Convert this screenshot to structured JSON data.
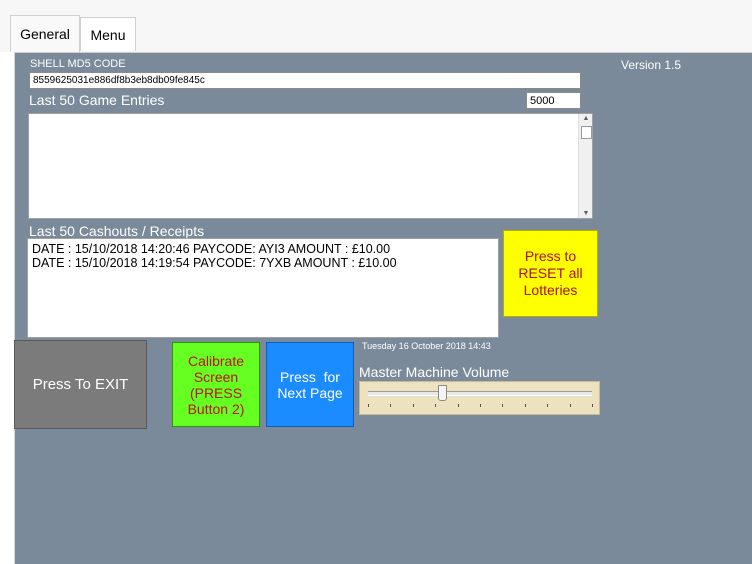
{
  "tabs": [
    {
      "label": "General",
      "active": true
    },
    {
      "label": "Menu",
      "active": false
    }
  ],
  "version": "Version 1.5",
  "shell_md5": {
    "label": "SHELL MD5 CODE",
    "value": "8559625031e886df8b3eb8db09fe845c"
  },
  "game_entries": {
    "label": "Last 50 Game Entries",
    "count_value": "5000",
    "lines": []
  },
  "cashouts": {
    "label": "Last 50 Cashouts / Receipts",
    "lines": [
      "DATE : 15/10/2018 14:20:46 PAYCODE: AYI3 AMOUNT : £10.00",
      "DATE : 15/10/2018 14:19:54 PAYCODE: 7YXB AMOUNT : £10.00"
    ]
  },
  "buttons": {
    "reset": "Press to RESET all Lotteries",
    "exit": "Press To EXIT",
    "calibrate": "Calibrate Screen (PRESS Button 2)",
    "next_page": "Press  for Next Page"
  },
  "datetime": "Tuesday 16 October 2018 14:43",
  "volume": {
    "label": "Master Machine Volume",
    "level": 0.33,
    "tick_count": 11
  },
  "colors": {
    "panel": "#7b8a9a",
    "exit": "#7b7b7b",
    "calibrate": "#66ff22",
    "next_page": "#1a8cff",
    "reset": "#ffff00",
    "slider_bg": "#ede2bf"
  },
  "icons": [
    "scroll-up-arrow-icon",
    "scroll-down-arrow-icon"
  ]
}
